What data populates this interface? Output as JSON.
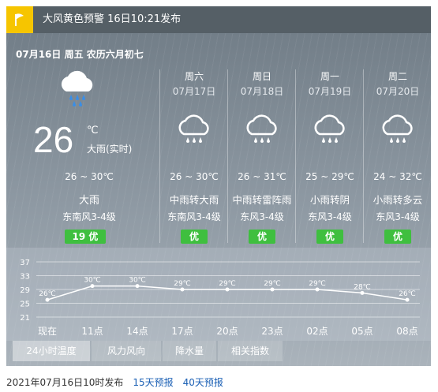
{
  "warning": {
    "text": "大风黄色预警 16日10:21发布",
    "icon": "flag-icon"
  },
  "date_line": "07月16日 周五 农历六月初七",
  "today": {
    "temp": "26",
    "unit": "℃",
    "realtime": "大雨(实时)",
    "range": "26 ~ 30℃",
    "condition": "大雨",
    "wind": "东南风3-4级",
    "aqi": "19 优"
  },
  "forecast": [
    {
      "week": "周六",
      "date": "07月17日",
      "range": "26 ~ 30℃",
      "condition": "中雨转大雨",
      "wind": "东南风3-4级",
      "aqi": "优"
    },
    {
      "week": "周日",
      "date": "07月18日",
      "range": "26 ~ 31℃",
      "condition": "中雨转雷阵雨",
      "wind": "东风3-4级",
      "aqi": "优"
    },
    {
      "week": "周一",
      "date": "07月19日",
      "range": "25 ~ 29℃",
      "condition": "小雨转阴",
      "wind": "东风3-4级",
      "aqi": "优"
    },
    {
      "week": "周二",
      "date": "07月20日",
      "range": "24 ~ 32℃",
      "condition": "小雨转多云",
      "wind": "东风3-4级",
      "aqi": "优"
    }
  ],
  "chart_data": {
    "type": "line",
    "categories": [
      "现在",
      "11点",
      "14点",
      "17点",
      "20点",
      "23点",
      "02点",
      "05点",
      "08点"
    ],
    "values": [
      26,
      30,
      30,
      29,
      29,
      29,
      29,
      28,
      26
    ],
    "point_labels": [
      "26℃",
      "30℃",
      "30℃",
      "29℃",
      "29℃",
      "29℃",
      "29℃",
      "28℃",
      "26℃"
    ],
    "yticks": [
      "37",
      "33",
      "29",
      "25",
      "21"
    ],
    "ylim": [
      21,
      37
    ],
    "grid": true
  },
  "tabs": [
    "24小时温度",
    "风力风向",
    "降水量",
    "相关指数"
  ],
  "footer": {
    "published": "2021年07月16日10时发布",
    "link15": "15天预报",
    "link40": "40天预报"
  },
  "colors": {
    "aqi_good": "#3fbf3f",
    "warning": "#f6c500"
  }
}
